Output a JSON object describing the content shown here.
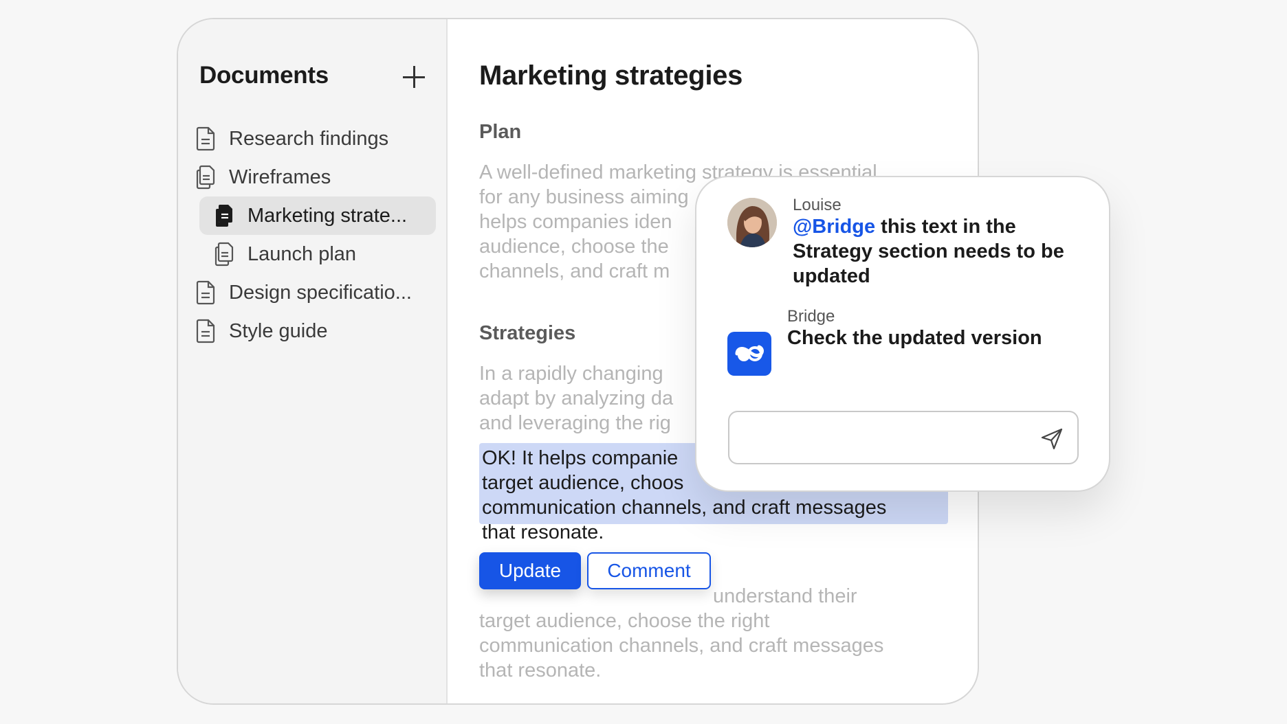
{
  "sidebar": {
    "title": "Documents",
    "items": [
      {
        "label": "Research findings",
        "icon": "document-icon"
      },
      {
        "label": "Wireframes",
        "icon": "documents-stack-icon"
      },
      {
        "label": "Marketing strate...",
        "icon": "documents-stack-icon",
        "active": true
      },
      {
        "label": "Launch plan",
        "icon": "documents-stack-icon"
      },
      {
        "label": "Design specificatio...",
        "icon": "document-icon"
      },
      {
        "label": "Style guide",
        "icon": "document-icon"
      }
    ]
  },
  "document": {
    "title": "Marketing strategies",
    "plan_heading": "Plan",
    "plan_text": "A well-defined marketing strategy is essential\nfor any business aiming\nhelps companies iden\naudience, choose the\nchannels, and craft m",
    "strategies_heading": "Strategies",
    "strategies_text": "In a rapidly changing\nadapt by analyzing da\nand leveraging the rig",
    "highlight_text": "OK! It helps companie\ntarget audience, choos\ncommunication channels, and craft messages\nthat resonate.",
    "after_text": "understand their\ntarget audience, choose the right\ncommunication channels, and craft messages\nthat resonate.",
    "update_label": "Update",
    "comment_label": "Comment"
  },
  "comments": {
    "first": {
      "author": "Louise",
      "mention": "@Bridge",
      "text": " this text in the Strategy section needs to be updated"
    },
    "second": {
      "author": "Bridge",
      "text": "Check the updated version"
    },
    "reply_placeholder": ""
  },
  "colors": {
    "accent": "#1755e6",
    "highlight": "#cdd8f6",
    "sidebar_bg": "#f4f4f4"
  }
}
